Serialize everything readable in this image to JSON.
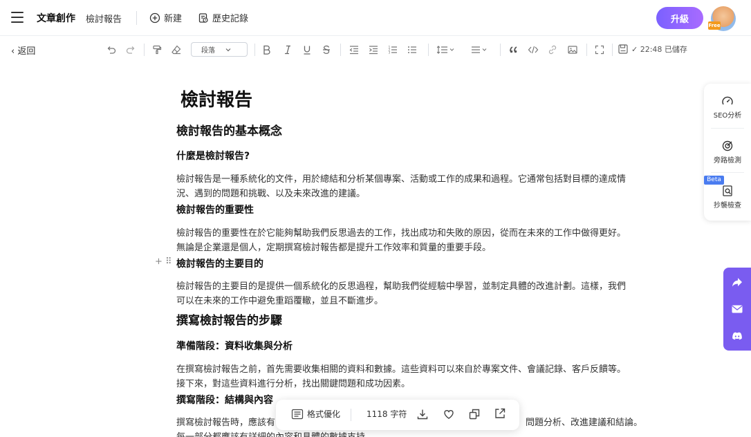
{
  "header": {
    "app_title": "文章創作",
    "doc_name": "檢討報告",
    "new_label": "新建",
    "history_label": "歷史記錄",
    "upgrade_label": "升級",
    "avatar_badge": "Free"
  },
  "toolbar": {
    "back_label": "返回",
    "paragraph_select": "段落",
    "saved_status": "✓ 22:48 已儲存"
  },
  "document": {
    "title": "檢討報告",
    "sections": [
      {
        "heading": "檢討報告的基本概念"
      },
      {
        "subheading": "什麼是檢討報告?",
        "paragraph_lines": [
          "檢討報告是一種系統化的文件，用於總結和分析某個專案、活動或工作的成果和過程。它通常包括對目標的達成情",
          "況、遇到的問題和挑戰、以及未來改進的建議。"
        ]
      },
      {
        "subheading": "檢討報告的重要性",
        "paragraph_lines": [
          "檢討報告的重要性在於它能夠幫助我們反思過去的工作，找出成功和失敗的原因，從而在未來的工作中做得更好。",
          "無論是企業還是個人，定期撰寫檢討報告都是提升工作效率和質量的重要手段。"
        ]
      },
      {
        "subheading": "檢討報告的主要目的",
        "paragraph_lines": [
          "檢討報告的主要目的是提供一個系統化的反思過程，幫助我們從經驗中學習，並制定具體的改進計劃。這樣，我們",
          "可以在未來的工作中避免重蹈覆轍，並且不斷進步。"
        ]
      },
      {
        "heading": "撰寫檢討報告的步驟"
      },
      {
        "subheading": "準備階段：資料收集與分析",
        "paragraph_lines": [
          "在撰寫檢討報告之前，首先需要收集相關的資料和數據。這些資料可以來自於專案文件、會議記錄、客戶反饋等。",
          "接下來，對這些資料進行分析，找出關鍵問題和成功因素。"
        ]
      },
      {
        "subheading": "撰寫階段：結構與內容",
        "paragraph_lines": [
          "撰寫檢討報告時，應該有",
          "問題分析、改進建議和結論。",
          "每一部分都應該有詳細的內容和具體的數據支持。"
        ]
      }
    ]
  },
  "side_panel": {
    "seo_label": "SEO分析",
    "plagiarism_label": "旁路檢測",
    "beta_label": "Beta",
    "check_label": "抄襲檢查"
  },
  "bottom_bar": {
    "format_label": "格式優化",
    "char_count": "1118 字符"
  },
  "colors": {
    "accent": "#7b61ff",
    "purple_panel": "#7a5cf0",
    "beta_blue": "#4a7cf0",
    "badge_orange": "#f39a1c"
  }
}
